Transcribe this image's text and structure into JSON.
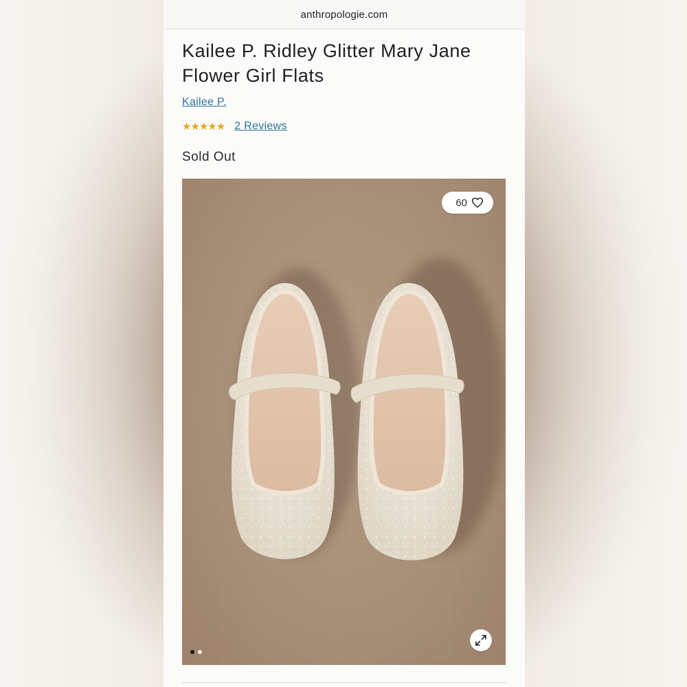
{
  "browser": {
    "url": "anthropologie.com"
  },
  "product": {
    "title": "Kailee P. Ridley Glitter Mary Jane Flower Girl Flats",
    "brand": "Kailee P.",
    "rating": {
      "stars": "★★★★★",
      "value": 5,
      "max": 5,
      "reviews_label": "2 Reviews"
    },
    "status": "Sold Out"
  },
  "gallery": {
    "favorites_count": "60",
    "current_image": 1,
    "image_count": 2,
    "icons": {
      "favorite": "heart-icon",
      "expand": "expand-icon"
    }
  },
  "colors": {
    "link": "#2d7396",
    "stars": "#e2a824"
  }
}
